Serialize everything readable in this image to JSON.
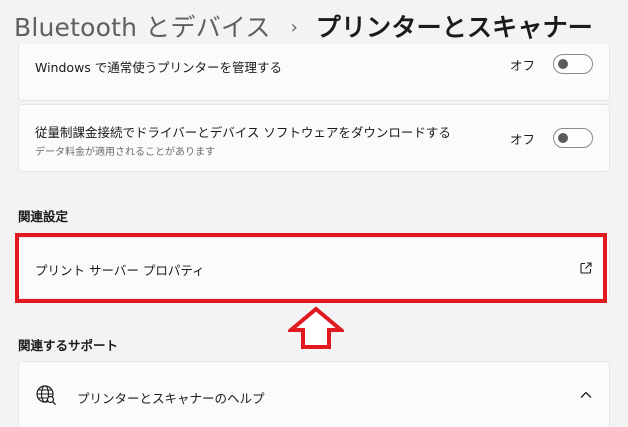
{
  "breadcrumb": {
    "parent": "Bluetooth とデバイス",
    "separator": "›",
    "current": "プリンターとスキャナー"
  },
  "settings": {
    "windows_manage": {
      "title": "Windows で通常使うプリンターを管理する",
      "toggle_label": "オフ"
    },
    "metered_download": {
      "title": "従量制課金接続でドライバーとデバイス ソフトウェアをダウンロードする",
      "subtitle": "データ料金が適用されることがあります",
      "toggle_label": "オフ"
    }
  },
  "related_settings": {
    "heading": "関連設定",
    "print_server": {
      "label": "プリント サーバー プロパティ",
      "icon": "external-link-icon"
    }
  },
  "related_support": {
    "heading": "関連するサポート",
    "help_item": {
      "label": "プリンターとスキャナーのヘルプ",
      "icon": "globe-search-icon"
    }
  },
  "colors": {
    "highlight": "#e11a22",
    "background": "#f3f3f3",
    "card": "#fbfbfb"
  }
}
